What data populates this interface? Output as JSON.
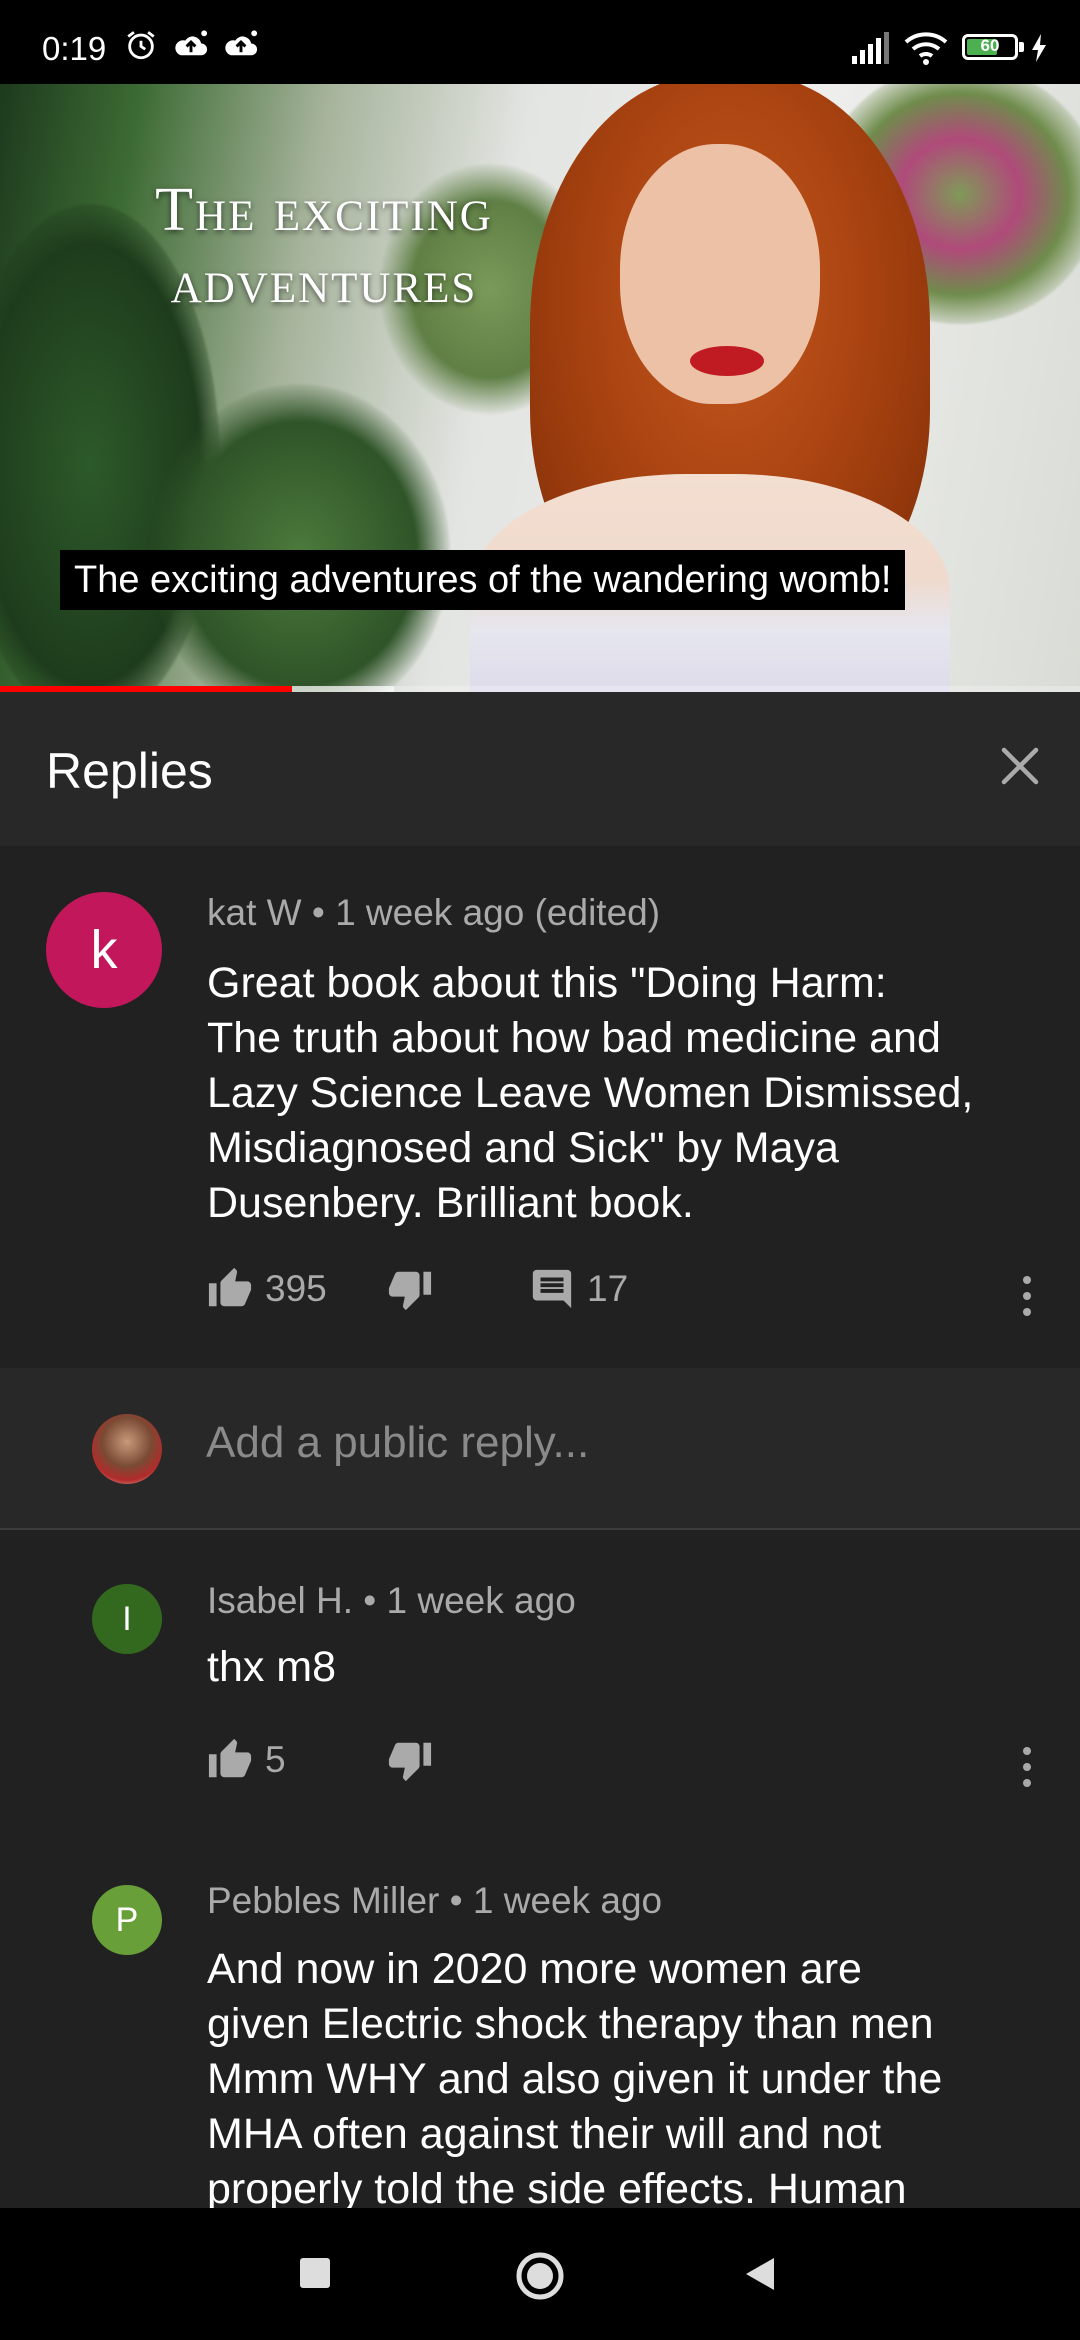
{
  "status_bar": {
    "time": "0:19",
    "battery": "60",
    "icons": [
      "alarm-icon",
      "cloud-upload-icon",
      "cloud-upload-icon",
      "signal-icon",
      "wifi-icon",
      "battery-icon",
      "charging-icon"
    ]
  },
  "video": {
    "title_overlay_line1": "The exciting",
    "title_overlay_line2": "adventures",
    "caption": "The exciting adventures of the wandering womb!",
    "played_fraction": 0.27,
    "buffered_fraction": 0.365
  },
  "replies": {
    "header_title": "Replies",
    "close_icon": "close-icon",
    "parent": {
      "avatar_letter": "k",
      "avatar_color": "#c2185b",
      "author": "kat W",
      "time": "1 week ago (edited)",
      "text_lines": [
        "Great book about this \"Doing Harm:",
        "The truth about how bad medicine and",
        "Lazy Science Leave Women Dismissed,",
        "Misdiagnosed and Sick\" by Maya",
        "Dusenbery.  Brilliant book."
      ],
      "likes": "395",
      "reply_count": "17"
    },
    "reply_input": {
      "placeholder": "Add a public reply..."
    },
    "items": [
      {
        "avatar_letter": "I",
        "avatar_color": "#33691e",
        "author": "Isabel H.",
        "time": "1 week ago",
        "text_lines": [
          "thx m8"
        ],
        "likes": "5"
      },
      {
        "avatar_letter": "P",
        "avatar_color": "#689f38",
        "author": "Pebbles Miller",
        "time": "1 week ago",
        "text_lines": [
          "And now in 2020 more women are",
          "given Electric shock therapy than men",
          "Mmm WHY and  also given it under the",
          "MHA   often against their will and not",
          "properly told the side effects. Human"
        ]
      }
    ]
  },
  "nav_bar": {
    "icons": [
      "recents-square-icon",
      "home-circle-icon",
      "back-triangle-icon"
    ]
  }
}
